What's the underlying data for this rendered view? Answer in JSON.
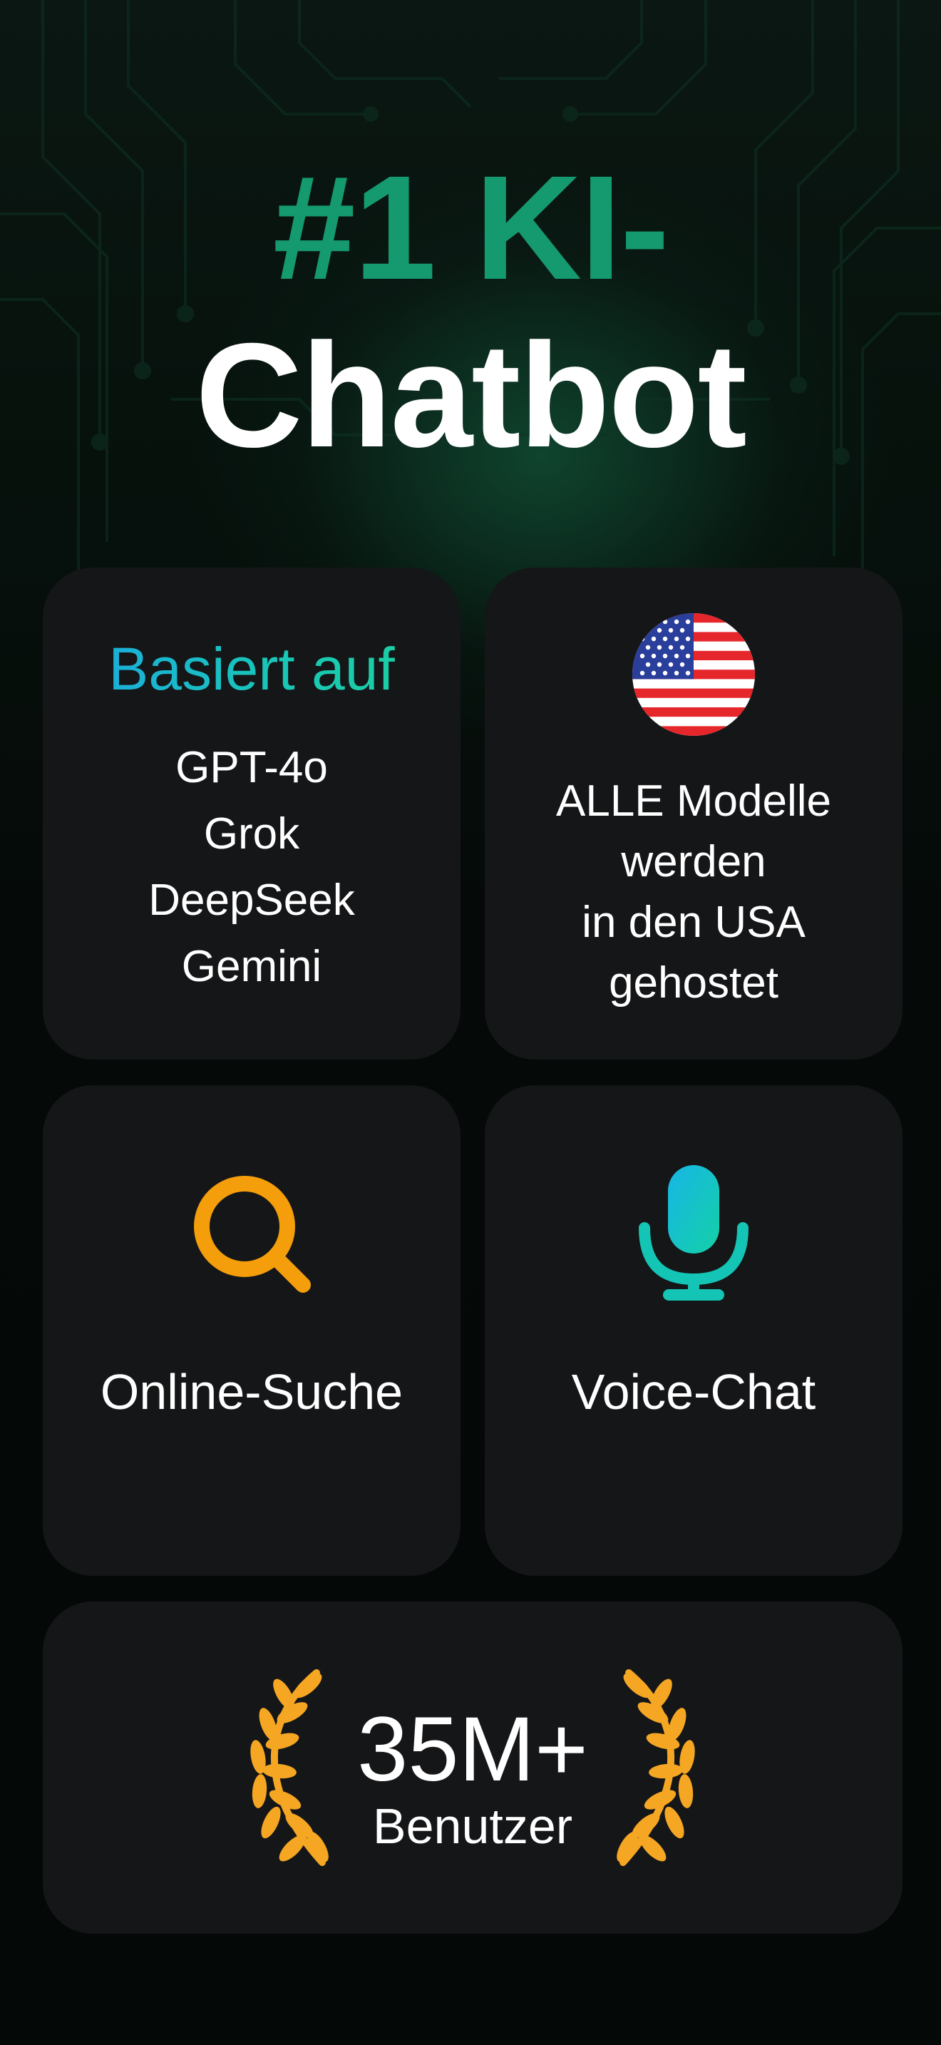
{
  "headline": {
    "line1": "#1 KI-",
    "line2": "Chatbot",
    "line1_color": "#15996f",
    "line2_color": "#ffffff"
  },
  "models_card": {
    "heading": "Basiert auf",
    "models": [
      "GPT-4o",
      "Grok",
      "DeepSeek",
      "Gemini"
    ]
  },
  "hosting_card": {
    "icon": "us-flag-icon",
    "lines": [
      "ALLE Modelle",
      "werden",
      "in den USA",
      "gehostet"
    ]
  },
  "search_card": {
    "icon": "search-icon",
    "label": "Online-Suche",
    "icon_color": "#f59e0b"
  },
  "voice_card": {
    "icon": "microphone-icon",
    "label": "Voice-Chat",
    "icon_color": "#14c4b4"
  },
  "users_card": {
    "count": "35M+",
    "label": "Benutzer",
    "icon": "laurel-wreath-icon",
    "icon_color": "#f5a623"
  },
  "colors": {
    "card_background": "#151618",
    "page_background": "#040806"
  }
}
